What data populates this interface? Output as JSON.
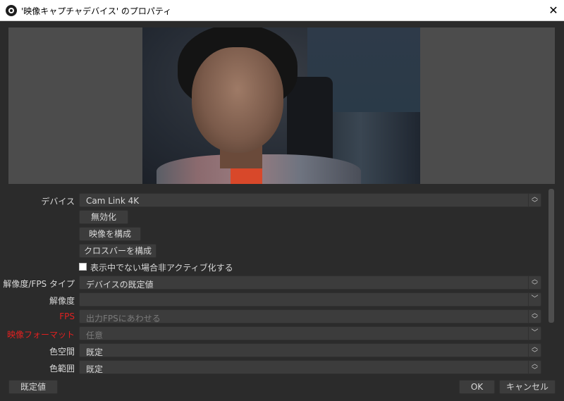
{
  "window": {
    "title": "'映像キャプチャデバイス' のプロパティ",
    "close_glyph": "✕",
    "app_icon": "obs-icon"
  },
  "preview": {
    "content": "webcam-video-feed"
  },
  "form": {
    "device_label": "デバイス",
    "device_value": "Cam Link 4K",
    "disable_button": "無効化",
    "configure_video_button": "映像を構成",
    "configure_crossbar_button": "クロスバーを構成",
    "deactivate_checkbox_label": "表示中でない場合非アクティブ化する",
    "deactivate_checked": false,
    "resolution_fps_type_label": "解像度/FPS タイプ",
    "resolution_fps_type_value": "デバイスの既定値",
    "resolution_label": "解像度",
    "resolution_value": "",
    "fps_label": "FPS",
    "fps_value": "出力FPSにあわせる",
    "video_format_label": "映像フォーマット",
    "video_format_value": "任意",
    "color_space_label": "色空間",
    "color_space_value": "既定",
    "color_range_label": "色範囲",
    "color_range_value": "既定"
  },
  "footer": {
    "defaults_button": "既定値",
    "ok_button": "OK",
    "cancel_button": "キャンセル"
  },
  "colors": {
    "background": "#2b2b2b",
    "control": "#3c3c3c",
    "warning_label": "#e02020"
  }
}
